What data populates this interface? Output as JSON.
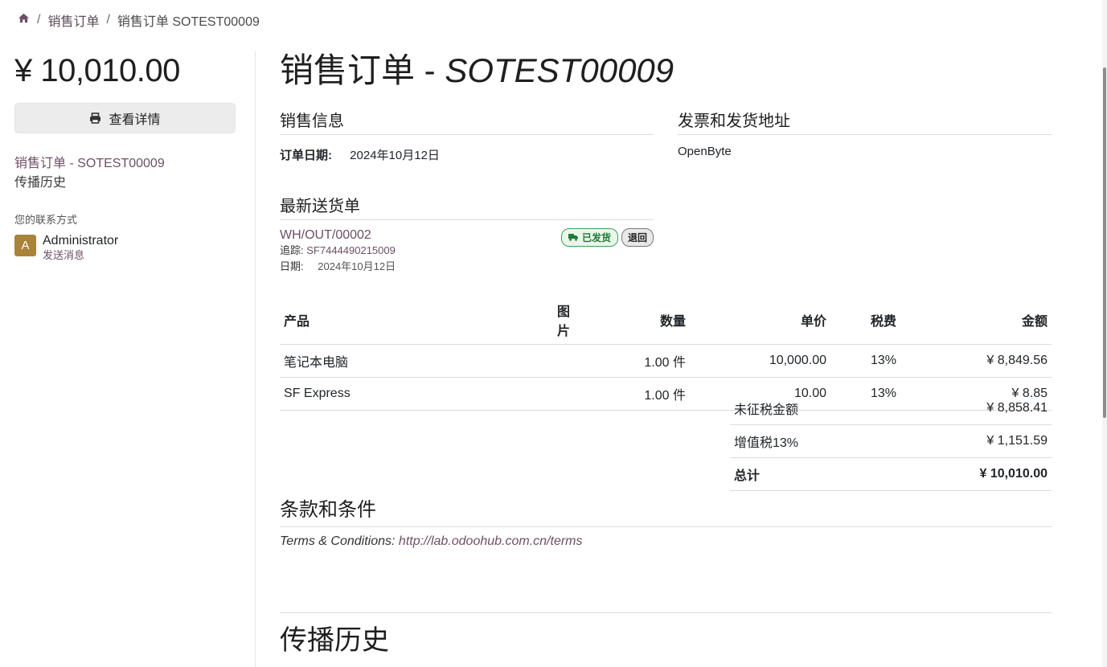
{
  "breadcrumb": {
    "home_icon": "home-icon",
    "items": [
      "销售订单",
      "销售订单 SOTEST00009"
    ]
  },
  "sidebar": {
    "amount": "¥ 10,010.00",
    "view_details_label": "查看详情",
    "print_icon": "printer-icon",
    "links": [
      "销售订单 - SOTEST00009",
      "传播历史"
    ],
    "contact_label": "您的联系方式",
    "contact": {
      "avatar_letter": "A",
      "name": "Administrator",
      "send_message": "发送消息"
    }
  },
  "main": {
    "title_prefix": "销售订单 - ",
    "title_number": "SOTEST00009",
    "sales_info": {
      "heading": "销售信息",
      "order_date_label": "订单日期:",
      "order_date_value": "2024年10月12日"
    },
    "address": {
      "heading": "发票和发货地址",
      "value": "OpenByte"
    },
    "delivery": {
      "heading": "最新送货单",
      "reference": "WH/OUT/00002",
      "status_badge": "已发货",
      "truck_icon": "truck-icon",
      "return_label": "退回",
      "tracking_label": "追踪:",
      "tracking_value": "SF7444490215009",
      "date_label": "日期:",
      "date_value": "2024年10月12日"
    },
    "table": {
      "headers": [
        "产品",
        "图片",
        "数量",
        "单价",
        "税费",
        "金额"
      ],
      "rows": [
        {
          "product": "笔记本电脑",
          "qty": "1.00 件",
          "unit_price": "10,000.00",
          "tax": "13%",
          "amount": "¥ 8,849.56"
        },
        {
          "product": "SF Express",
          "qty": "1.00 件",
          "unit_price": "10.00",
          "tax": "13%",
          "amount": "¥ 8.85"
        }
      ]
    },
    "totals": {
      "untaxed_label": "未征税金额",
      "untaxed_value": "¥ 8,858.41",
      "vat_label": "增值税13%",
      "vat_value": "¥ 1,151.59",
      "total_label": "总计",
      "total_value": "¥ 10,010.00"
    },
    "terms": {
      "heading": "条款和条件",
      "text": "Terms & Conditions: ",
      "link": "http://lab.odoohub.com.cn/terms"
    },
    "history_heading": "传播历史"
  }
}
